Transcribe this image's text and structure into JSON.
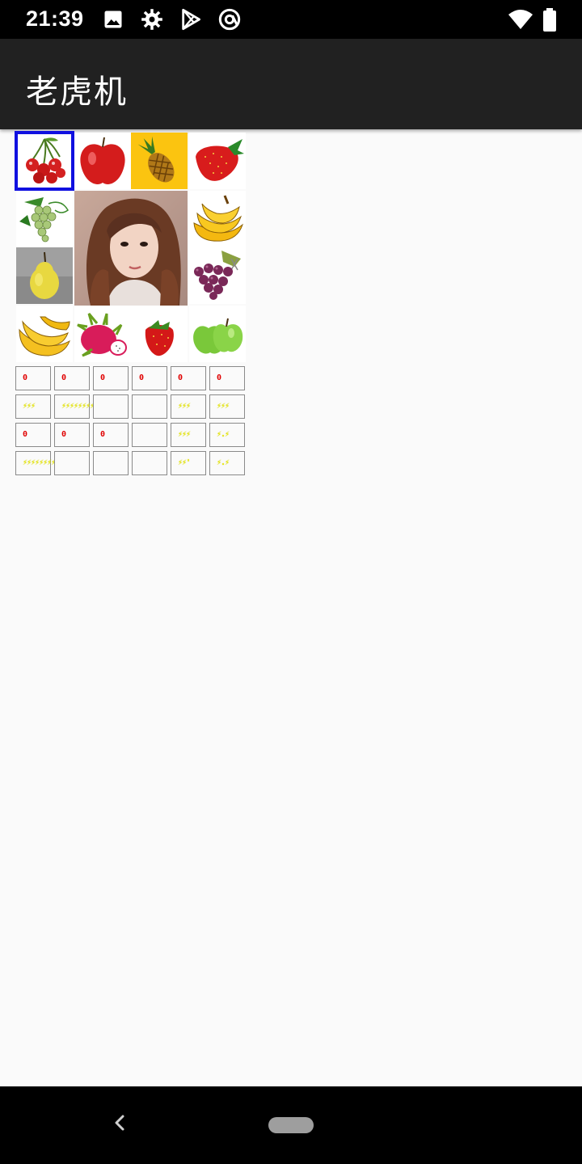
{
  "status_bar": {
    "time": "21:39",
    "icons": [
      "image-icon",
      "settings-icon",
      "play-store-icon",
      "at-sign-icon",
      "wifi-icon",
      "battery-icon"
    ]
  },
  "app_bar": {
    "title": "老虎机",
    "background": "#212121"
  },
  "board": {
    "selected_index": 0,
    "selection_color": "#1010e0",
    "cells": [
      {
        "fruit": "cherry"
      },
      {
        "fruit": "apple"
      },
      {
        "fruit": "pineapple"
      },
      {
        "fruit": "strawberry"
      },
      {
        "fruit": "grapes-green"
      },
      {
        "fruit": "banana"
      },
      {
        "fruit": "pear"
      },
      {
        "fruit": "grapes-purple"
      },
      {
        "fruit": "banana"
      },
      {
        "fruit": "dragon-fruit"
      },
      {
        "fruit": "strawberry"
      },
      {
        "fruit": "apple-green"
      }
    ]
  },
  "bets": {
    "row1": [
      "0",
      "0",
      "0",
      "0",
      "0",
      "0"
    ],
    "row2": [
      "⚡⚡⚡",
      "⚡⚡⚡⚡⚡⚡⚡⚡⚡⚡⚡⚡",
      "",
      "",
      "⚡⚡⚡",
      "⚡⚡⚡"
    ],
    "row3": [
      "0",
      "0",
      "0",
      "",
      "⚡⚡⚡",
      "⚡.⚡"
    ],
    "row4": [
      "⚡⚡⚡⚡⚡⚡⚡⚡⚡⚡⚡⚡⚡⚡⚡",
      "",
      "",
      "",
      "⚡⚡'",
      "⚡.⚡"
    ]
  },
  "colors": {
    "counter_red": "#e00000",
    "counter_yellow": "#e8e800"
  }
}
